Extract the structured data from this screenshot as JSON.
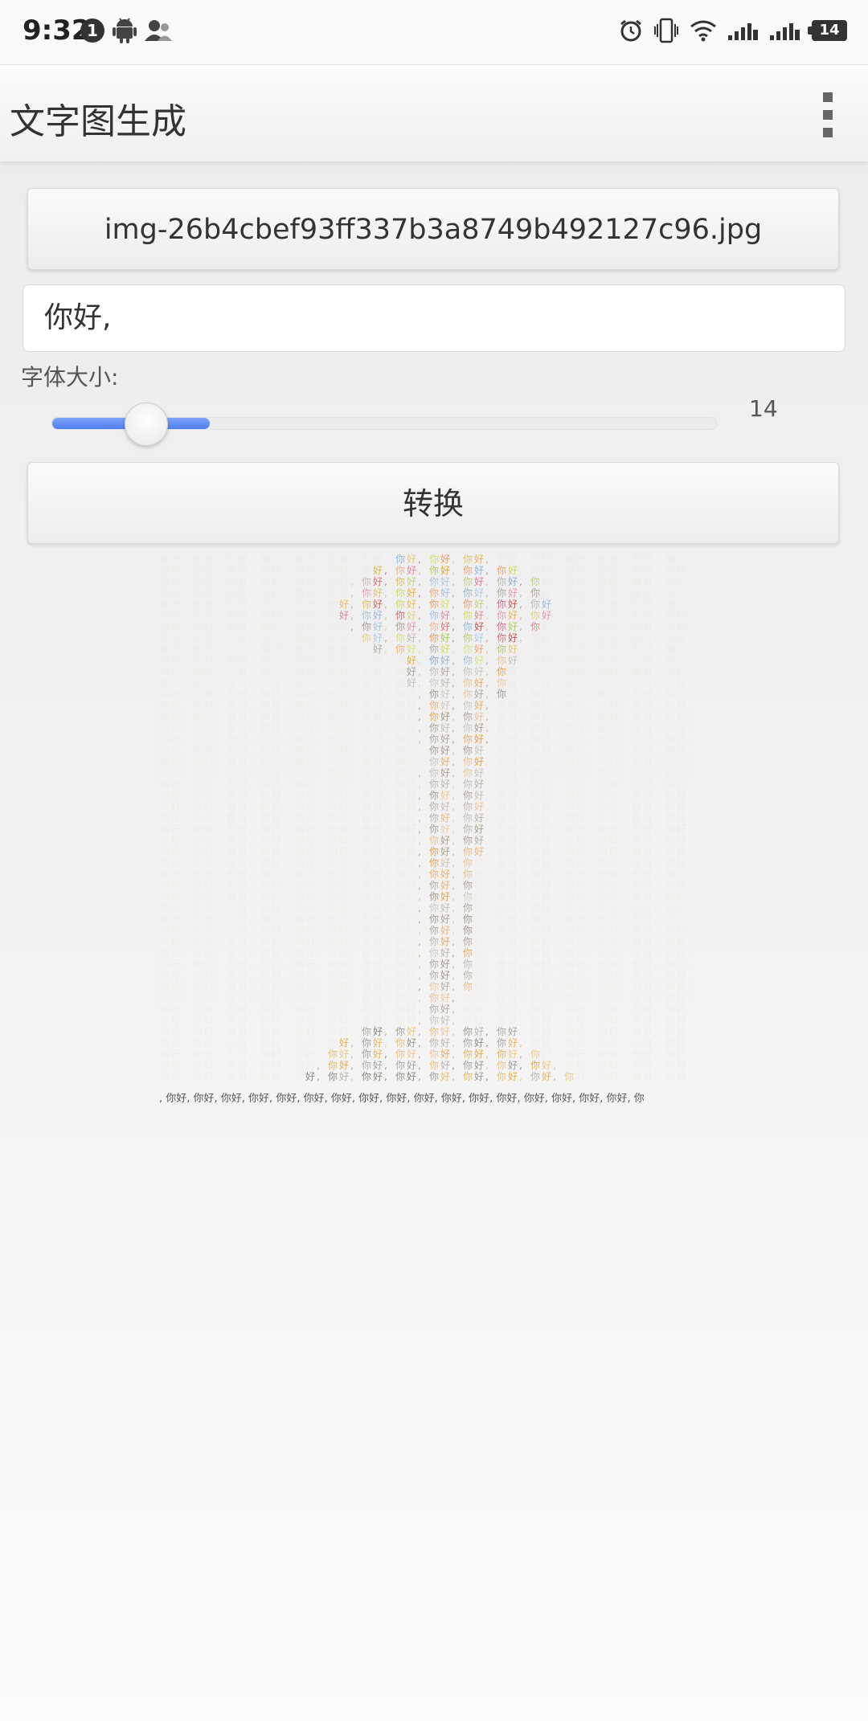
{
  "status_bar": {
    "time": "9:32",
    "notification_count": "1",
    "battery_level": "14",
    "left_icons": [
      "notification-badge-icon",
      "android-icon",
      "contacts-icon"
    ],
    "right_icons": [
      "alarm-icon",
      "vibrate-icon",
      "wifi-icon",
      "signal-1-icon",
      "signal-2-icon",
      "battery-icon"
    ]
  },
  "app_bar": {
    "title": "文字图生成",
    "menu_icon": "overflow-menu-icon"
  },
  "form": {
    "file_button_label": "img-26b4cbef93ff337b3a8749b492127c96.jpg",
    "text_input_value": "你好,",
    "font_size_label": "字体大小:",
    "font_size_value": "14",
    "slider_fraction": 0.14,
    "convert_button_label": "转换"
  },
  "result": {
    "grid_text": "你好,",
    "caption_line": ", 你好, 你好, 你好, 你好, 你好, 你好, 你好, 你好, 你好, 你好, 你好, 你好, 你好, 你好, 你好, 你好, 你好, 你"
  },
  "colors": {
    "accent": "#4f7ef0",
    "background": "#f0f0f0",
    "text": "#333333"
  }
}
